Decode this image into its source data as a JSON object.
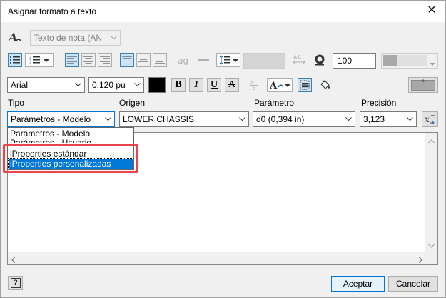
{
  "window": {
    "title": "Asignar formato a texto"
  },
  "toolbar1": {
    "style_value": "Texto de nota (AN"
  },
  "toolbar2": {
    "spacing_value": "100"
  },
  "toolbar3": {
    "font_value": "Arial",
    "size_value": "0,120 pu",
    "bold_label": "B",
    "italic_label": "I",
    "underline_label": "U",
    "strike_label": "A"
  },
  "labels": {
    "tipo": "Tipo",
    "origen": "Origen",
    "parametro": "Parámetro",
    "precision": "Precisión"
  },
  "combos": {
    "tipo": "Parámetros - Modelo",
    "origen": "LOWER CHASSIS",
    "parametro": "d0 (0,394 in)",
    "precision": "3,123"
  },
  "dropdown": {
    "items": [
      "Parámetros - Modelo",
      "Parámetros - Usuario",
      "iProperties estándar",
      "iProperties personalizadas"
    ]
  },
  "buttons": {
    "ok": "Aceptar",
    "cancel": "Cancelar",
    "help": "?"
  },
  "colors": {
    "accent": "#0078d7",
    "highlight": "#e8464c",
    "selected_text_color": "#000000"
  }
}
